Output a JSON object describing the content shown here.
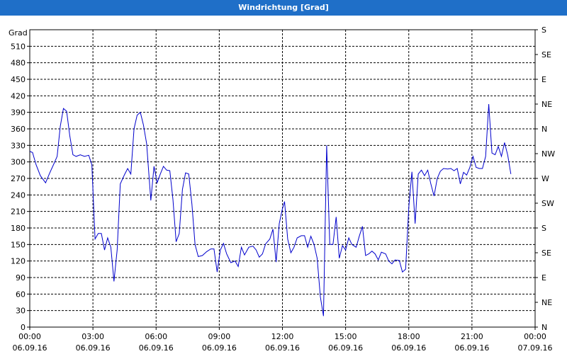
{
  "window": {
    "title": "Windrichtung [Grad]"
  },
  "chart_data": {
    "type": "line",
    "title": "Windrichtung [Grad]",
    "ylabel": "Grad",
    "ylim": [
      0,
      540
    ],
    "yticks": [
      0,
      30,
      60,
      90,
      120,
      150,
      180,
      210,
      240,
      270,
      300,
      330,
      360,
      390,
      420,
      450,
      480,
      510
    ],
    "right_axis_labels": [
      "N",
      "NE",
      "E",
      "SE",
      "S",
      "SW",
      "W",
      "NW",
      "N",
      "NE",
      "E",
      "SE",
      "S"
    ],
    "right_axis_values": [
      0,
      45,
      90,
      135,
      180,
      225,
      270,
      315,
      360,
      405,
      450,
      495,
      540
    ],
    "x_range_hours": [
      0,
      24
    ],
    "x_ticks": [
      {
        "time": "00:00",
        "date": "06.09.16"
      },
      {
        "time": "03:00",
        "date": "06.09.16"
      },
      {
        "time": "06:00",
        "date": "06.09.16"
      },
      {
        "time": "09:00",
        "date": "06.09.16"
      },
      {
        "time": "12:00",
        "date": "06.09.16"
      },
      {
        "time": "15:00",
        "date": "06.09.16"
      },
      {
        "time": "18:00",
        "date": "06.09.16"
      },
      {
        "time": "21:00",
        "date": "06.09.16"
      },
      {
        "time": "00:00",
        "date": "07.09.16"
      }
    ],
    "grid": true,
    "series": [
      {
        "color": "#0000cc",
        "points": [
          [
            0.0,
            319
          ],
          [
            0.13,
            317
          ],
          [
            0.3,
            295
          ],
          [
            0.5,
            275
          ],
          [
            0.75,
            262
          ],
          [
            0.95,
            280
          ],
          [
            1.15,
            297
          ],
          [
            1.3,
            310
          ],
          [
            1.45,
            365
          ],
          [
            1.6,
            397
          ],
          [
            1.75,
            392
          ],
          [
            1.9,
            348
          ],
          [
            2.05,
            313
          ],
          [
            2.2,
            310
          ],
          [
            2.4,
            313
          ],
          [
            2.6,
            310
          ],
          [
            2.8,
            312
          ],
          [
            2.95,
            295
          ],
          [
            3.1,
            160
          ],
          [
            3.25,
            170
          ],
          [
            3.4,
            170
          ],
          [
            3.55,
            140
          ],
          [
            3.7,
            162
          ],
          [
            3.85,
            145
          ],
          [
            4.0,
            83
          ],
          [
            4.15,
            140
          ],
          [
            4.3,
            260
          ],
          [
            4.5,
            277
          ],
          [
            4.65,
            288
          ],
          [
            4.8,
            278
          ],
          [
            4.95,
            360
          ],
          [
            5.1,
            385
          ],
          [
            5.25,
            390
          ],
          [
            5.4,
            367
          ],
          [
            5.55,
            333
          ],
          [
            5.75,
            230
          ],
          [
            5.9,
            292
          ],
          [
            6.05,
            262
          ],
          [
            6.2,
            278
          ],
          [
            6.35,
            292
          ],
          [
            6.5,
            285
          ],
          [
            6.65,
            284
          ],
          [
            6.8,
            232
          ],
          [
            6.95,
            155
          ],
          [
            7.1,
            170
          ],
          [
            7.25,
            250
          ],
          [
            7.4,
            280
          ],
          [
            7.55,
            278
          ],
          [
            7.7,
            223
          ],
          [
            7.85,
            150
          ],
          [
            8.0,
            128
          ],
          [
            8.2,
            130
          ],
          [
            8.4,
            137
          ],
          [
            8.6,
            142
          ],
          [
            8.75,
            142
          ],
          [
            8.9,
            100
          ],
          [
            9.05,
            140
          ],
          [
            9.2,
            152
          ],
          [
            9.35,
            133
          ],
          [
            9.55,
            117
          ],
          [
            9.75,
            120
          ],
          [
            9.9,
            110
          ],
          [
            10.05,
            145
          ],
          [
            10.2,
            131
          ],
          [
            10.4,
            145
          ],
          [
            10.6,
            147
          ],
          [
            10.75,
            140
          ],
          [
            10.9,
            127
          ],
          [
            11.05,
            133
          ],
          [
            11.2,
            151
          ],
          [
            11.4,
            160
          ],
          [
            11.55,
            178
          ],
          [
            11.7,
            118
          ],
          [
            11.85,
            188
          ],
          [
            12.0,
            215
          ],
          [
            12.1,
            228
          ],
          [
            12.25,
            160
          ],
          [
            12.4,
            135
          ],
          [
            12.55,
            145
          ],
          [
            12.7,
            162
          ],
          [
            12.9,
            166
          ],
          [
            13.05,
            166
          ],
          [
            13.2,
            145
          ],
          [
            13.35,
            165
          ],
          [
            13.5,
            150
          ],
          [
            13.65,
            125
          ],
          [
            13.8,
            55
          ],
          [
            13.95,
            20
          ],
          [
            14.1,
            330
          ],
          [
            14.25,
            150
          ],
          [
            14.4,
            150
          ],
          [
            14.55,
            200
          ],
          [
            14.7,
            125
          ],
          [
            14.85,
            148
          ],
          [
            15.0,
            140
          ],
          [
            15.15,
            162
          ],
          [
            15.3,
            150
          ],
          [
            15.5,
            145
          ],
          [
            15.65,
            165
          ],
          [
            15.8,
            183
          ],
          [
            15.95,
            130
          ],
          [
            16.1,
            133
          ],
          [
            16.25,
            138
          ],
          [
            16.4,
            133
          ],
          [
            16.55,
            122
          ],
          [
            16.7,
            136
          ],
          [
            16.9,
            133
          ],
          [
            17.05,
            120
          ],
          [
            17.2,
            115
          ],
          [
            17.35,
            122
          ],
          [
            17.55,
            121
          ],
          [
            17.7,
            100
          ],
          [
            17.85,
            105
          ],
          [
            18.0,
            218
          ],
          [
            18.15,
            282
          ],
          [
            18.3,
            188
          ],
          [
            18.45,
            278
          ],
          [
            18.6,
            285
          ],
          [
            18.75,
            275
          ],
          [
            18.9,
            285
          ],
          [
            19.05,
            260
          ],
          [
            19.2,
            238
          ],
          [
            19.35,
            270
          ],
          [
            19.5,
            283
          ],
          [
            19.65,
            288
          ],
          [
            19.85,
            287
          ],
          [
            20.0,
            288
          ],
          [
            20.15,
            284
          ],
          [
            20.3,
            288
          ],
          [
            20.45,
            260
          ],
          [
            20.6,
            281
          ],
          [
            20.75,
            276
          ],
          [
            20.9,
            290
          ],
          [
            21.05,
            310
          ],
          [
            21.2,
            290
          ],
          [
            21.35,
            288
          ],
          [
            21.5,
            288
          ],
          [
            21.65,
            310
          ],
          [
            21.8,
            405
          ],
          [
            21.95,
            316
          ],
          [
            22.1,
            313
          ],
          [
            22.25,
            328
          ],
          [
            22.4,
            310
          ],
          [
            22.55,
            335
          ],
          [
            22.7,
            312
          ],
          [
            22.85,
            278
          ]
        ]
      }
    ]
  }
}
